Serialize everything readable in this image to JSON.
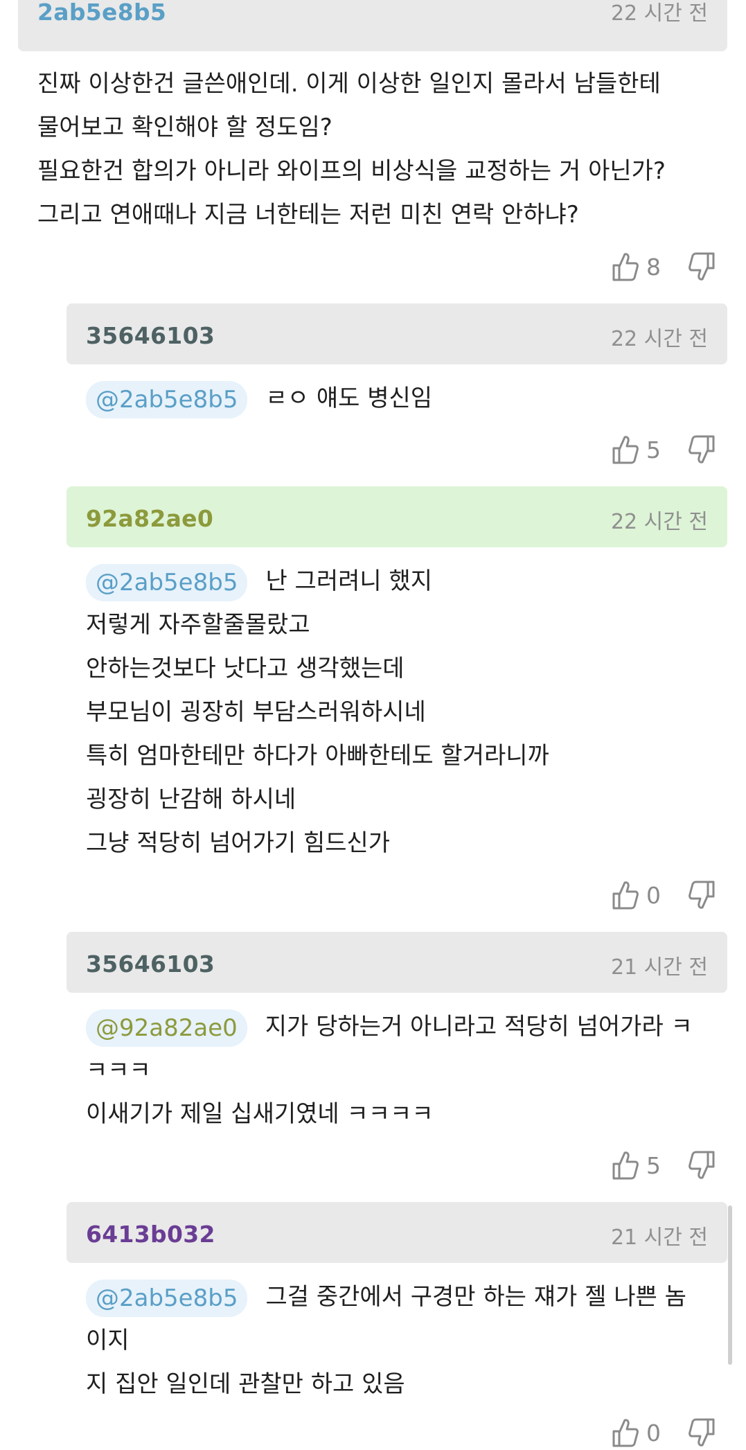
{
  "comments": [
    {
      "author": "2ab5e8b5",
      "author_color": "#5a9fc6",
      "time": "22 시간 전",
      "lines": [
        "진짜 이상한건 글쓴애인데. 이게 이상한 일인지 몰라서 남들한테",
        "물어보고 확인해야 할 정도임?",
        "필요한건 합의가 아니라 와이프의 비상식을 교정하는 거 아닌가?",
        "그리고 연애때나 지금 너한테는 저런 미친 연락 안하냐?"
      ],
      "likes": "8"
    },
    {
      "author": "35646103",
      "author_color": "#4e6163",
      "time": "22 시간 전",
      "mention": "@2ab5e8b5",
      "mention_color": "#5a9fc6",
      "first_line": "ㄹㅇ 얘도 병신임",
      "lines": [],
      "likes": "5"
    },
    {
      "author": "92a82ae0",
      "author_color": "#8d9a3c",
      "time": "22 시간 전",
      "mention": "@2ab5e8b5",
      "mention_color": "#5a9fc6",
      "first_line": "난 그러려니 했지",
      "lines": [
        "저렇게 자주할줄몰랐고",
        "안하는것보다 낫다고 생각했는데",
        "부모님이 굉장히 부담스러워하시네",
        "특히 엄마한테만 하다가 아빠한테도 할거라니까",
        "굉장히 난감해 하시네",
        "그냥 적당히 넘어가기 힘드신가"
      ],
      "likes": "0"
    },
    {
      "author": "35646103",
      "author_color": "#4e6163",
      "time": "21 시간 전",
      "mention": "@92a82ae0",
      "mention_color": "#8d9a3c",
      "first_line": "지가 당하는거 아니라고 적당히 넘어가라 ㅋ",
      "lines": [
        "ㅋㅋㅋ",
        "이새기가 제일 십새기였네 ㅋㅋㅋㅋ"
      ],
      "likes": "5"
    },
    {
      "author": "6413b032",
      "author_color": "#6a3d94",
      "time": "21 시간 전",
      "mention": "@2ab5e8b5",
      "mention_color": "#5a9fc6",
      "first_line": "그걸 중간에서 구경만 하는 쟤가 젤 나쁜 놈",
      "lines": [
        "이지",
        "지 집안 일인데 관찰만 하고 있음"
      ],
      "likes": "0"
    }
  ],
  "icons": {
    "like": "thumbs-up-icon",
    "dislike": "thumbs-down-icon"
  },
  "colors": {
    "header_bg": "#e9e9e9",
    "highlight_bg": "#ddf4d6",
    "mention_bg": "#e7f2fb"
  }
}
